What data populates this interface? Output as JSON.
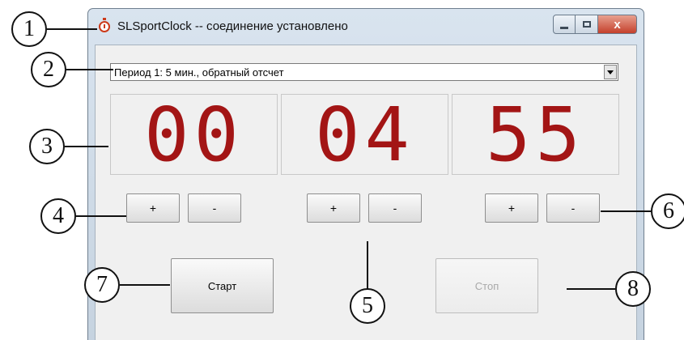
{
  "window": {
    "title": "SLSportClock -- соединение установлено",
    "icon": "stopwatch-icon",
    "controls": {
      "minimize": "minimize-icon",
      "maximize": "maximize-icon",
      "close": "x"
    }
  },
  "period_select": {
    "selected": "Период 1: 5 мин., обратный отсчет"
  },
  "clock": {
    "hours": "00",
    "minutes": "04",
    "seconds": "55",
    "digit_color": "#a31515"
  },
  "adjust": {
    "plus": "+",
    "minus": "-"
  },
  "actions": {
    "start_label": "Старт",
    "stop_label": "Стоп"
  },
  "callouts": [
    "1",
    "2",
    "3",
    "4",
    "5",
    "6",
    "7",
    "8"
  ]
}
